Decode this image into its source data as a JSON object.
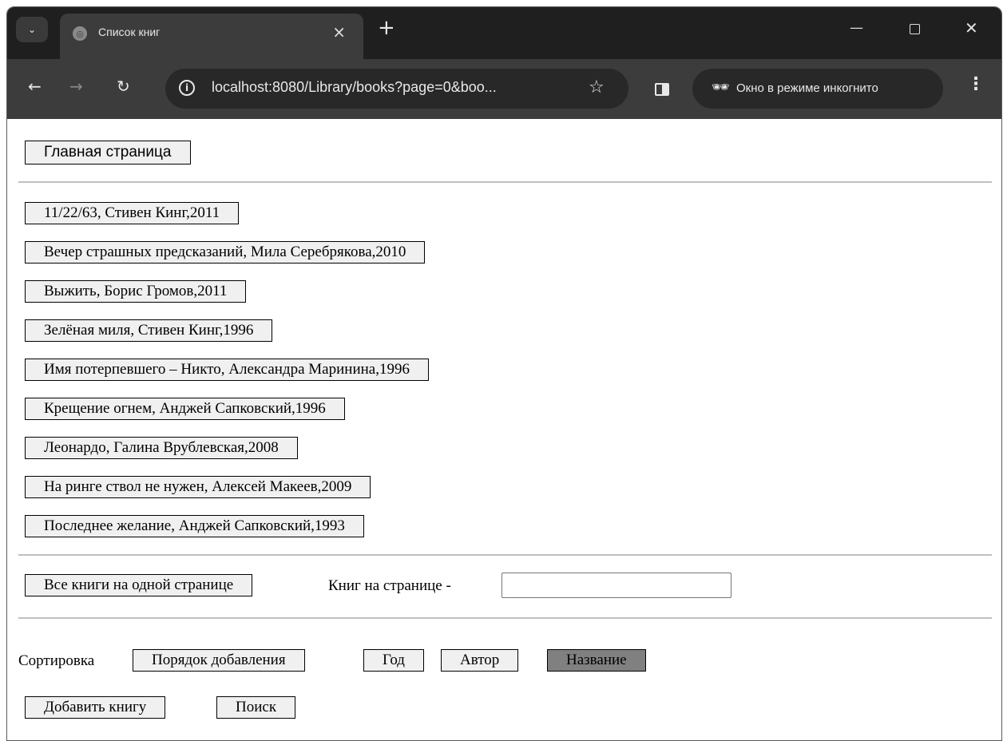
{
  "browser": {
    "tab_title": "Список книг",
    "url": "localhost:8080/Library/books?page=0&boo...",
    "incognito_label": "Окно в режиме инкогнито"
  },
  "page": {
    "home_button": "Главная страница",
    "books": [
      "11/22/63, Стивен Кинг,2011",
      "Вечер страшных предсказаний, Мила Серебрякова,2010",
      "Выжить, Борис Громов,2011",
      "Зелёная миля, Стивен Кинг,1996",
      "Имя потерпевшего – Никто, Александра Маринина,1996",
      "Крещение огнем, Анджей Сапковский,1996",
      "Леонардо, Галина Врублевская,2008",
      "На ринге ствол не нужен, Алексей Макеев,2009",
      "Последнее желание, Анджей Сапковский,1993"
    ],
    "all_books_button": "Все книги на одной странице",
    "per_page_label": "Книг на странице -",
    "per_page_value": "",
    "sort_label": "Сортировка",
    "sort_buttons": [
      "Порядок добавления",
      "Год",
      "Автор",
      "Название"
    ],
    "sort_active": "Название",
    "add_book_button": "Добавить книгу",
    "search_button": "Поиск"
  }
}
